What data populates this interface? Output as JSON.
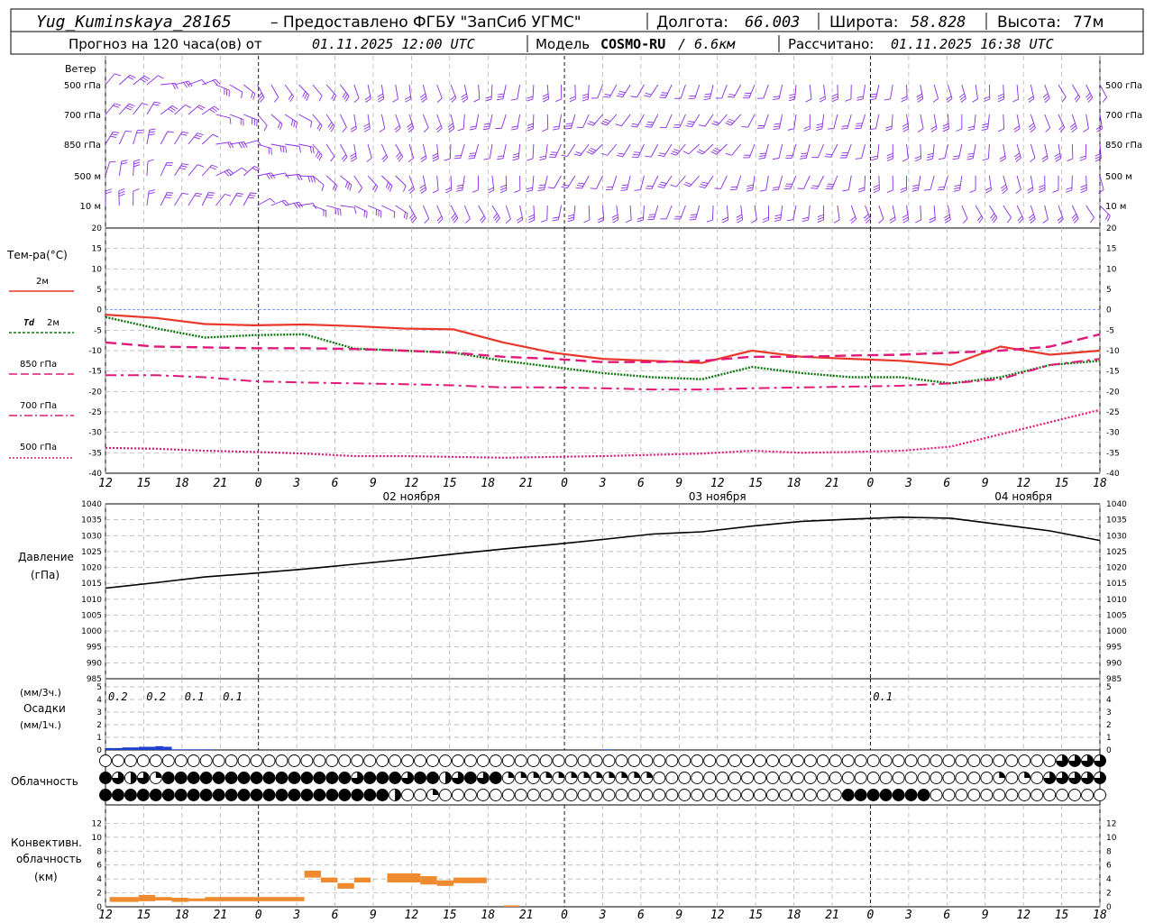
{
  "header": {
    "station": "Yug_Kuminskaya_28165",
    "provider": " – Предоставлено ФГБУ \"ЗапСиб УГМС\" ",
    "lon_label": "Долгота:",
    "lon_value": "66.003",
    "lat_label": "Широта:",
    "lat_value": "58.828",
    "alt_label": "Высота:",
    "alt_value": "77м",
    "forecast_label": "Прогноз на 120 часа(ов) от",
    "forecast_time": "01.11.2025 12:00 UTC",
    "model_label": "Модель",
    "model_name": "COSMO-RU",
    "model_res": "/ 6.6км",
    "calc_label": "Рассчитано:",
    "calc_time": "01.11.2025 16:38 UTC"
  },
  "colors": {
    "wind": "#8a2be2",
    "t2m": "#e8382c",
    "td2m": "#117711",
    "t850": "#e0197a",
    "pressure": "#000000",
    "precip": "#1c3fcf",
    "convective": "#ef8a2e",
    "zero_line": "#3366ff"
  },
  "time_axis": {
    "ticks": [
      "12",
      "15",
      "18",
      "21",
      "0",
      "3",
      "6",
      "9",
      "12",
      "15",
      "18",
      "21",
      "0",
      "3",
      "6",
      "9",
      "12",
      "15",
      "18",
      "21",
      "0",
      "3",
      "6",
      "9",
      "12",
      "15",
      "18"
    ],
    "day_labels": [
      {
        "index": 8,
        "text": "02 ноября"
      },
      {
        "index": 16,
        "text": "03 ноября"
      },
      {
        "index": 24,
        "text": "04 ноября"
      }
    ],
    "midnight_indices": [
      4,
      12,
      20
    ]
  },
  "wind_panel": {
    "title": "Ветер",
    "levels": [
      "500 гПа",
      "700 гПа",
      "850 гПа",
      "500 м",
      "10 м"
    ]
  },
  "chart_data": [
    {
      "type": "line",
      "title": "Тем-ра(°С)",
      "ylim": [
        -40,
        20
      ],
      "yticks": [
        20,
        15,
        10,
        5,
        0,
        -5,
        -10,
        -15,
        -20,
        -25,
        -30,
        -35,
        -40
      ],
      "x_hours": [
        0,
        6,
        12,
        18,
        24,
        30,
        36,
        42,
        48,
        54,
        60,
        66,
        72,
        78,
        84,
        90,
        96,
        102,
        108,
        114,
        120
      ],
      "series": [
        {
          "name": "2м",
          "values": [
            -1.2,
            -2.0,
            -3.5,
            -3.8,
            -3.6,
            -4.0,
            -4.6,
            -4.8,
            -8.0,
            -10.5,
            -12.0,
            -12.5,
            -13.0,
            -10.0,
            -11.5,
            -12.0,
            -12.5,
            -13.5,
            -9.0,
            -11.0,
            -10.0
          ]
        },
        {
          "name": "Td 2м",
          "values": [
            -1.8,
            -4.5,
            -6.8,
            -6.2,
            -6.0,
            -9.5,
            -10.0,
            -10.5,
            -12.5,
            -14.0,
            -15.5,
            -16.5,
            -17.0,
            -14.0,
            -15.5,
            -16.5,
            -16.5,
            -18.0,
            -16.5,
            -13.5,
            -12.5
          ]
        },
        {
          "name": "850 гПа",
          "values": [
            -8.0,
            -9.0,
            -9.2,
            -9.4,
            -9.4,
            -9.6,
            -10.0,
            -10.5,
            -11.5,
            -12.0,
            -12.8,
            -12.8,
            -12.5,
            -11.5,
            -11.5,
            -11.2,
            -11.0,
            -10.5,
            -10.0,
            -9.0,
            -6.0
          ]
        },
        {
          "name": "700 гПа",
          "values": [
            -16.0,
            -16.0,
            -16.5,
            -17.5,
            -17.8,
            -18.0,
            -18.2,
            -18.5,
            -19.0,
            -19.0,
            -19.2,
            -19.5,
            -19.5,
            -19.2,
            -19.0,
            -18.8,
            -18.6,
            -18.0,
            -17.0,
            -13.5,
            -12.0
          ]
        },
        {
          "name": "500 гПа",
          "values": [
            -33.8,
            -34.0,
            -34.5,
            -34.8,
            -35.2,
            -35.8,
            -35.8,
            -36.0,
            -36.2,
            -36.0,
            -35.8,
            -35.5,
            -35.2,
            -34.5,
            -35.0,
            -34.8,
            -34.5,
            -33.5,
            -30.5,
            -27.5,
            -24.5
          ]
        }
      ]
    },
    {
      "type": "line",
      "title": "Давление",
      "ylabel": "(гПа)",
      "ylim": [
        985,
        1040
      ],
      "yticks": [
        1040,
        1035,
        1030,
        1025,
        1020,
        1015,
        1010,
        1005,
        1000,
        995,
        990,
        985
      ],
      "x_hours": [
        0,
        6,
        12,
        18,
        24,
        30,
        36,
        42,
        48,
        54,
        60,
        66,
        72,
        78,
        84,
        90,
        96,
        102,
        108,
        114,
        120
      ],
      "series": [
        {
          "name": "Давление",
          "values": [
            1013.5,
            1015.2,
            1017.0,
            1018.2,
            1019.5,
            1021.0,
            1022.5,
            1024.2,
            1025.8,
            1027.2,
            1028.8,
            1030.5,
            1031.2,
            1033.0,
            1034.5,
            1035.2,
            1035.8,
            1035.5,
            1033.5,
            1031.5,
            1028.5
          ]
        }
      ]
    },
    {
      "type": "bar",
      "title": "Осадки",
      "ylabel_top": "(мм/3ч.)",
      "ylabel_bottom": "(мм/1ч.)",
      "ylim": [
        0,
        5
      ],
      "yticks": [
        5,
        4,
        3,
        2,
        1,
        0
      ],
      "annotations": [
        {
          "index": 0,
          "text": "0.2"
        },
        {
          "index": 1,
          "text": "0.2"
        },
        {
          "index": 2,
          "text": "0.1"
        },
        {
          "index": 3,
          "text": "0.1"
        },
        {
          "index": 20,
          "text": "0.1"
        }
      ],
      "bars_hourly": [
        {
          "hour": 0,
          "value": 0.15
        },
        {
          "hour": 1,
          "value": 0.15
        },
        {
          "hour": 2,
          "value": 0.2
        },
        {
          "hour": 3,
          "value": 0.2
        },
        {
          "hour": 4,
          "value": 0.25
        },
        {
          "hour": 5,
          "value": 0.25
        },
        {
          "hour": 6,
          "value": 0.3
        },
        {
          "hour": 7,
          "value": 0.25
        },
        {
          "hour": 8,
          "value": 0.05
        },
        {
          "hour": 9,
          "value": 0.05
        },
        {
          "hour": 10,
          "value": 0.05
        },
        {
          "hour": 11,
          "value": 0.05
        },
        {
          "hour": 12,
          "value": 0.05
        },
        {
          "hour": 60,
          "value": 0.05
        }
      ]
    },
    {
      "type": "table",
      "title": "Облачность",
      "rows": 3,
      "note": "cloud cover per time step (0-4 quarters)"
    },
    {
      "type": "bar",
      "title": "Конвективн.",
      "subtitle": "облачность",
      "ylabel": "(км)",
      "ylim": [
        0,
        14
      ],
      "yticks": [
        12,
        10,
        8,
        6,
        4,
        2,
        0
      ],
      "spans": [
        {
          "from": 0.5,
          "to": 4,
          "low": 0.7,
          "high": 1.4
        },
        {
          "from": 4,
          "to": 6,
          "low": 0.8,
          "high": 1.7
        },
        {
          "from": 6,
          "to": 8,
          "low": 0.9,
          "high": 1.4
        },
        {
          "from": 8,
          "to": 10,
          "low": 0.7,
          "high": 1.3
        },
        {
          "from": 10,
          "to": 12,
          "low": 0.8,
          "high": 1.2
        },
        {
          "from": 12,
          "to": 24,
          "low": 0.8,
          "high": 1.4
        },
        {
          "from": 24,
          "to": 26,
          "low": 4.2,
          "high": 5.2
        },
        {
          "from": 26,
          "to": 28,
          "low": 3.5,
          "high": 4.2
        },
        {
          "from": 28,
          "to": 30,
          "low": 2.6,
          "high": 3.4
        },
        {
          "from": 30,
          "to": 32,
          "low": 3.5,
          "high": 4.2
        },
        {
          "from": 34,
          "to": 38,
          "low": 3.5,
          "high": 4.8
        },
        {
          "from": 38,
          "to": 40,
          "low": 3.2,
          "high": 4.4
        },
        {
          "from": 40,
          "to": 42,
          "low": 3.0,
          "high": 3.8
        },
        {
          "from": 42,
          "to": 46,
          "low": 3.4,
          "high": 4.2
        },
        {
          "from": 48,
          "to": 50,
          "low": 0.0,
          "high": 0.2
        }
      ]
    }
  ],
  "legend": {
    "t2m": "2м",
    "td_label": "Td",
    "td_level": "2м",
    "t850": "850 гПа",
    "t700": "700 гПа",
    "t500": "500 гПа"
  }
}
